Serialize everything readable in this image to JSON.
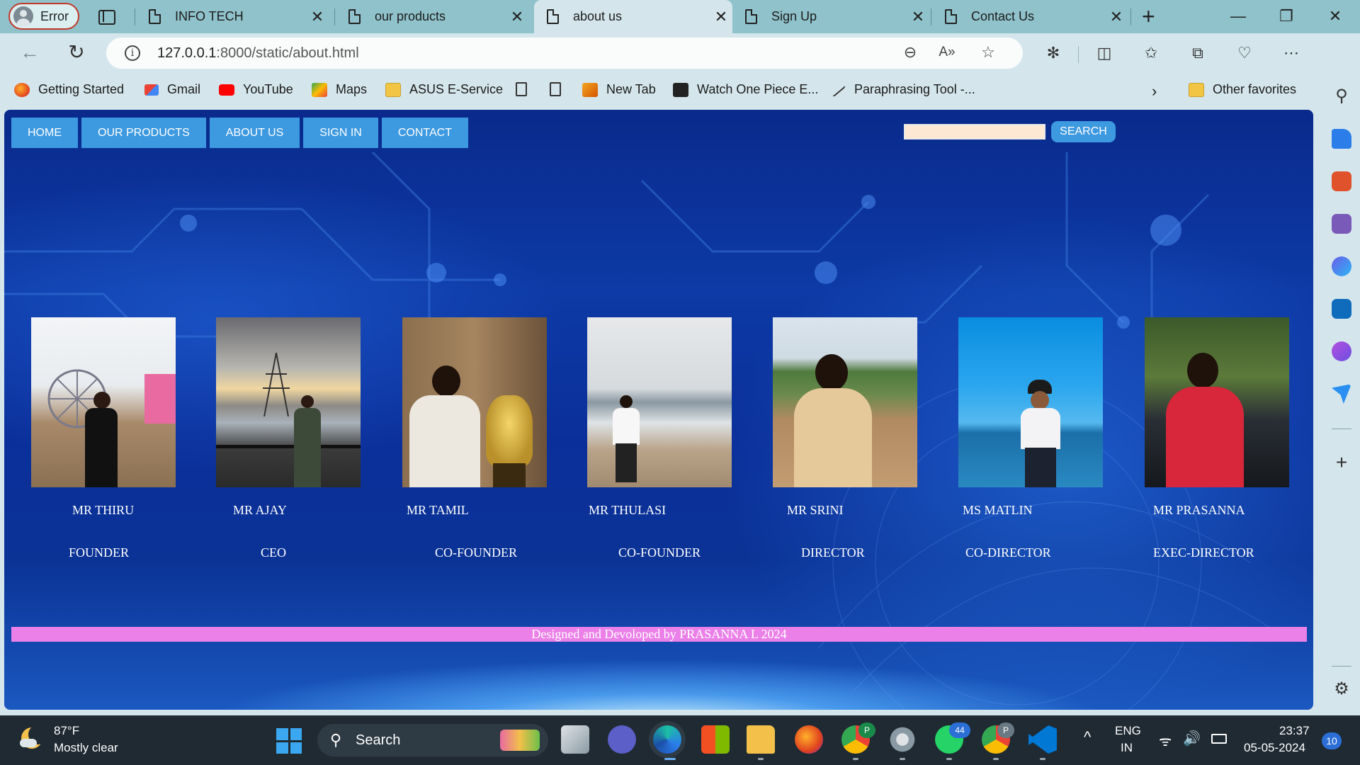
{
  "browser": {
    "profile_label": "Error",
    "tabs": [
      {
        "label": "INFO TECH"
      },
      {
        "label": "our products"
      },
      {
        "label": "about us"
      },
      {
        "label": "Sign Up"
      },
      {
        "label": "Contact Us"
      }
    ],
    "active_tab_index": 2,
    "url_host": "127.0.0.1",
    "url_path": ":8000/static/about.html",
    "bookmarks": [
      {
        "label": "Getting Started"
      },
      {
        "label": "Gmail"
      },
      {
        "label": "YouTube"
      },
      {
        "label": "Maps"
      },
      {
        "label": "ASUS E-Service"
      },
      {
        "label": "New Tab"
      },
      {
        "label": "Watch One Piece E..."
      },
      {
        "label": "Paraphrasing Tool -..."
      },
      {
        "label": "Other favorites"
      }
    ]
  },
  "site": {
    "nav": [
      "HOME",
      "OUR PRODUCTS",
      "ABOUT US",
      "SIGN IN",
      "CONTACT"
    ],
    "search_button": "SEARCH",
    "search_value": "",
    "members": [
      {
        "name": "MR THIRU",
        "role": "FOUNDER"
      },
      {
        "name": "MR AJAY",
        "role": "CEO"
      },
      {
        "name": "MR TAMIL",
        "role": "CO-FOUNDER"
      },
      {
        "name": "MR THULASI",
        "role": "CO-FOUNDER"
      },
      {
        "name": "MR SRINI",
        "role": "DIRECTOR"
      },
      {
        "name": "MS MATLIN",
        "role": "CO-DIRECTOR"
      },
      {
        "name": "MR PRASANNA",
        "role": "EXEC-DIRECTOR"
      }
    ],
    "footer": "Designed and Devoloped by PRASANNA L 2024"
  },
  "taskbar": {
    "temperature": "87°F",
    "condition": "Mostly clear",
    "search_label": "Search",
    "lang_line1": "ENG",
    "lang_line2": "IN",
    "time": "23:37",
    "date": "05-05-2024",
    "notification_count": "10",
    "whatsapp_badge": "44",
    "chrome_badge_1": "P",
    "chrome_badge_2": "P"
  }
}
